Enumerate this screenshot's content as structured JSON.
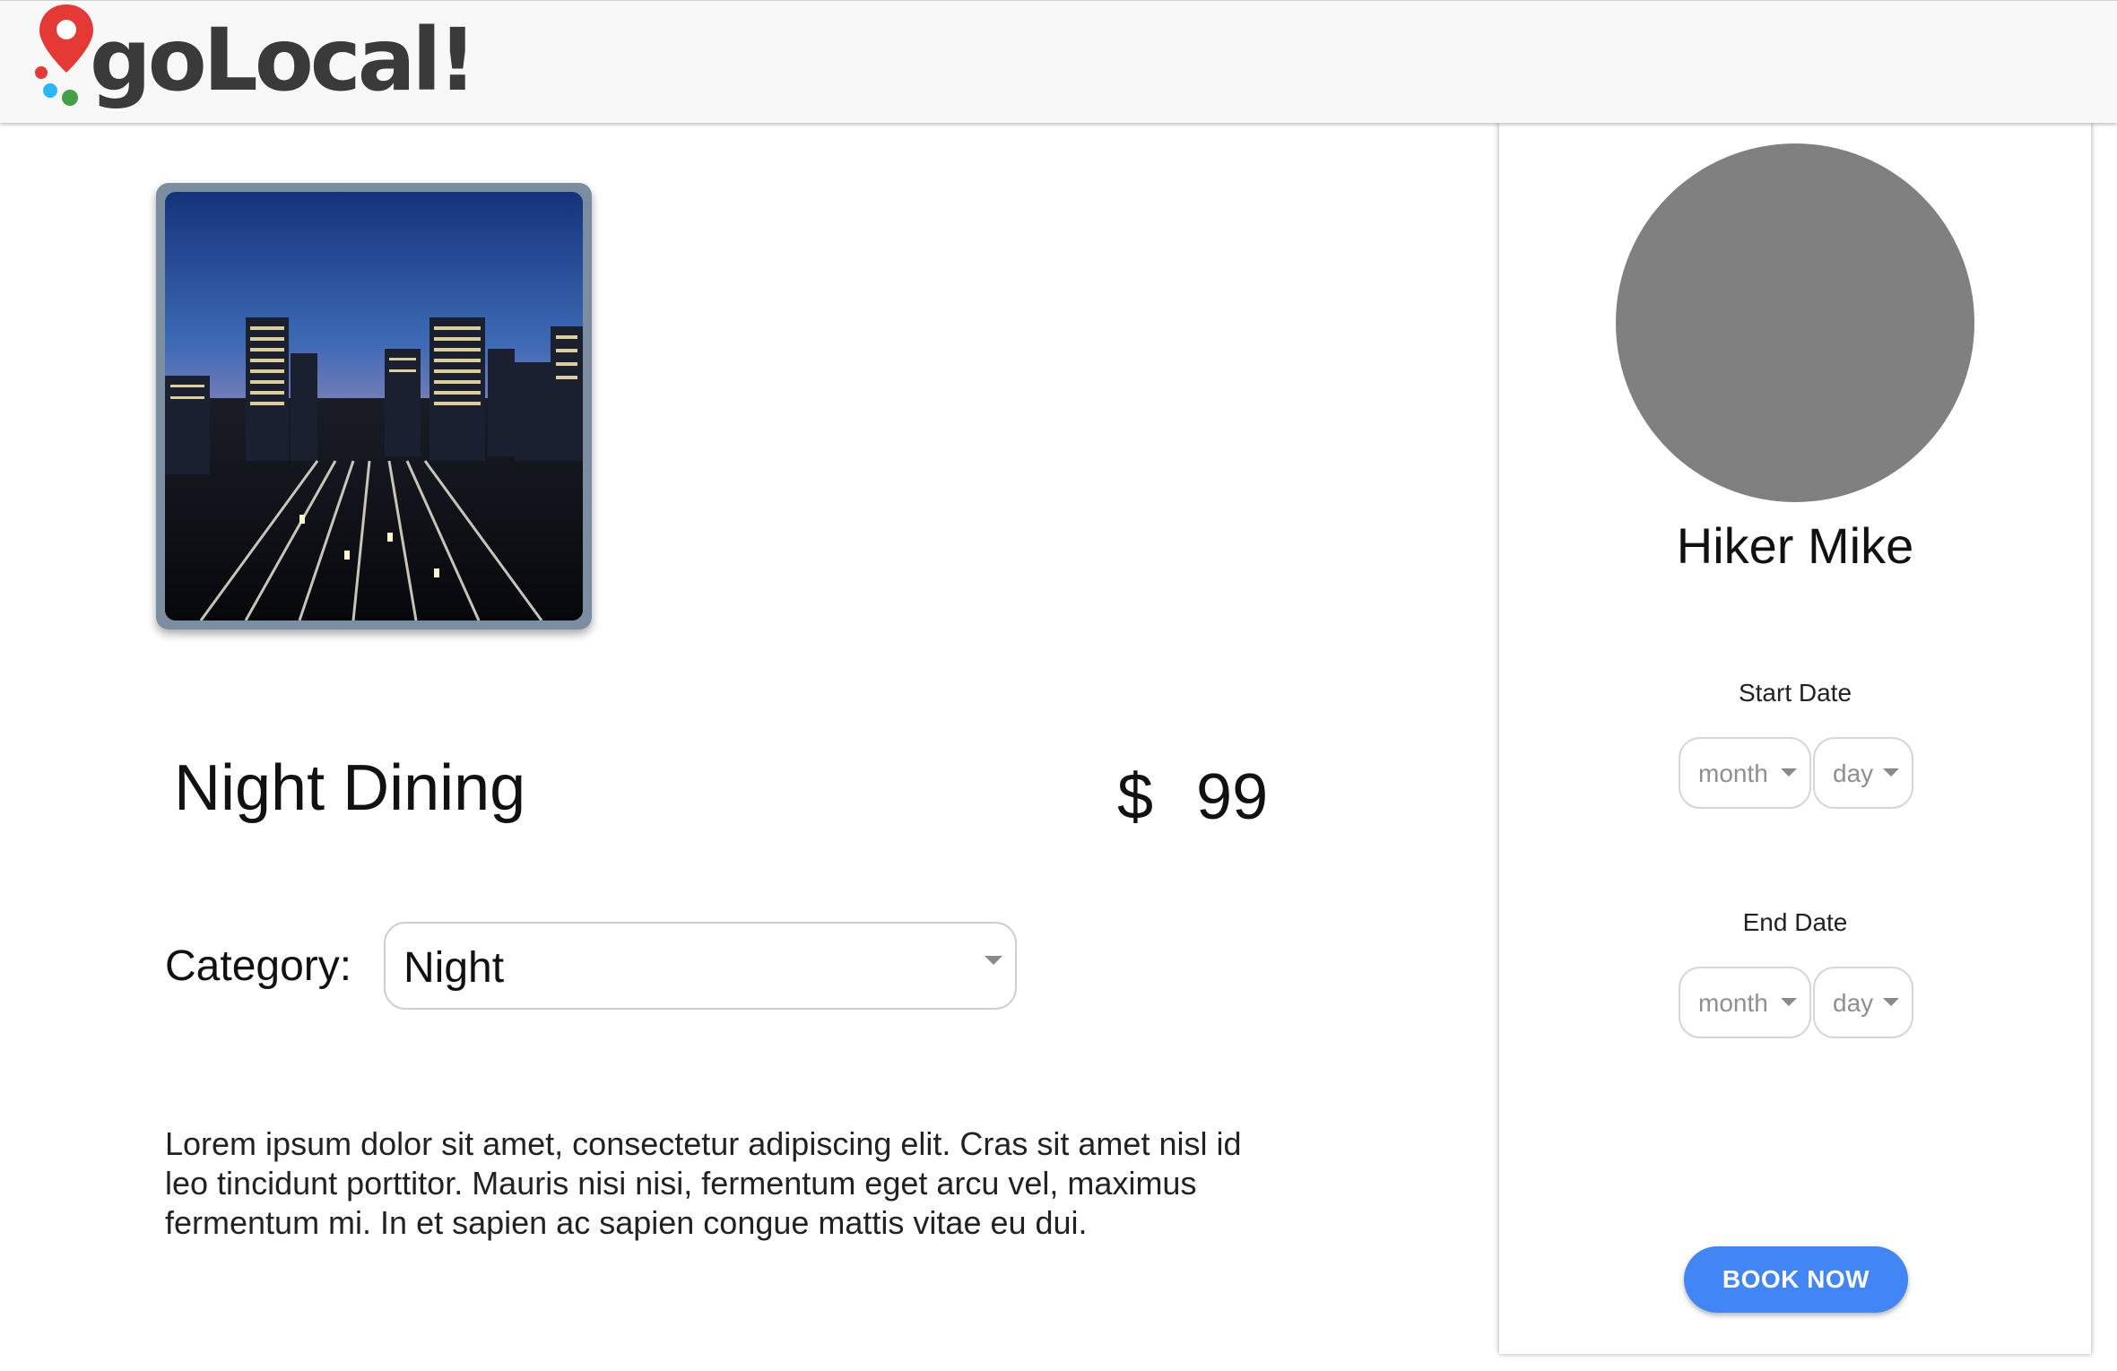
{
  "header": {
    "logo_text": "goLocal!"
  },
  "listing": {
    "image_icon": "city-night-photo",
    "title": "Night Dining",
    "currency": "$",
    "price": "99",
    "category_label": "Category:",
    "category_value": "Night",
    "description": "Lorem ipsum dolor sit amet, consectetur adipiscing elit. Cras sit amet nisl id leo tincidunt porttitor. Mauris nisi nisi, fermentum eget arcu vel, maximus fermentum mi. In et sapien ac sapien congue mattis vitae eu dui."
  },
  "booking": {
    "host_name": "Hiker Mike",
    "start_date": {
      "label": "Start Date",
      "month": "month",
      "day": "day"
    },
    "end_date": {
      "label": "End Date",
      "month": "month",
      "day": "day"
    },
    "book_label": "BOOK NOW"
  },
  "colors": {
    "accent": "#4285f4",
    "logo_pin": "#e53935",
    "avatar": "#808080"
  }
}
